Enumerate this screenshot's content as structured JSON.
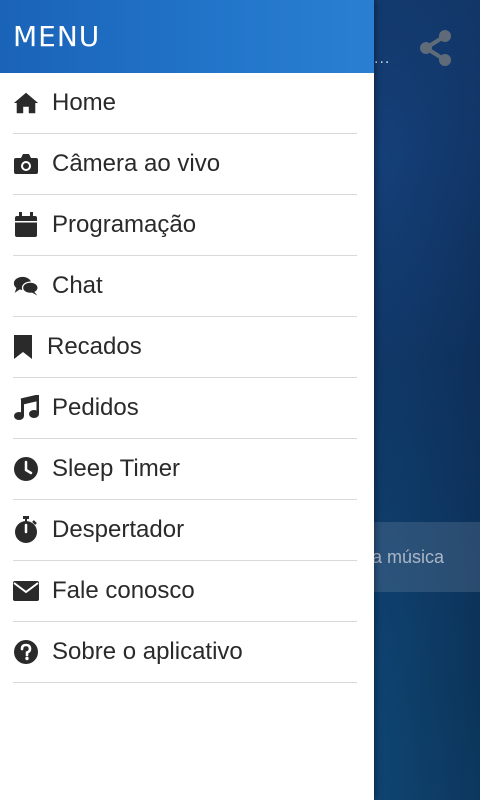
{
  "background": {
    "overflow_dots": "...",
    "song_text": "a música",
    "share_icon": "share-icon"
  },
  "drawer": {
    "title": "MENU",
    "accent_color": "#2174c9",
    "items": [
      {
        "label": "Home",
        "icon": "home-icon"
      },
      {
        "label": "Câmera ao vivo",
        "icon": "camera-icon"
      },
      {
        "label": "Programação",
        "icon": "calendar-icon"
      },
      {
        "label": "Chat",
        "icon": "chat-icon"
      },
      {
        "label": "Recados",
        "icon": "bookmark-icon"
      },
      {
        "label": "Pedidos",
        "icon": "music-icon"
      },
      {
        "label": "Sleep Timer",
        "icon": "clock-icon"
      },
      {
        "label": "Despertador",
        "icon": "stopwatch-icon"
      },
      {
        "label": "Fale conosco",
        "icon": "envelope-icon"
      },
      {
        "label": "Sobre o aplicativo",
        "icon": "question-icon"
      }
    ]
  }
}
